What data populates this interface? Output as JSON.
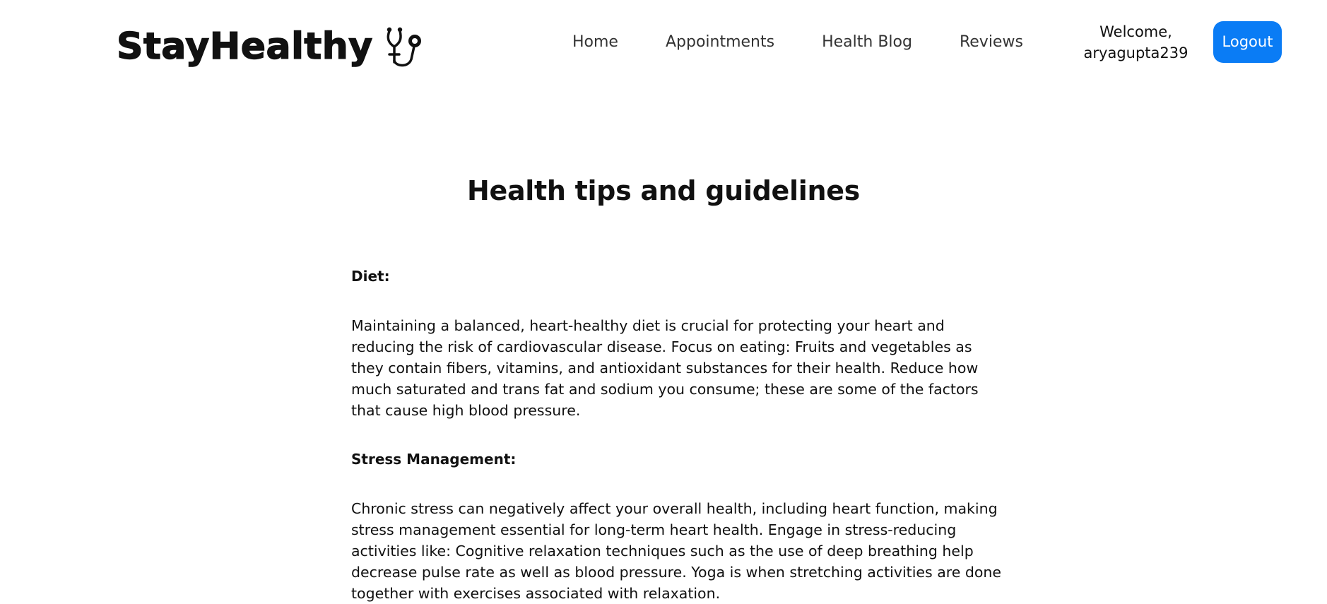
{
  "header": {
    "brand": "StayHealthy",
    "nav": [
      {
        "label": "Home"
      },
      {
        "label": "Appointments"
      },
      {
        "label": "Health Blog"
      },
      {
        "label": "Reviews"
      }
    ],
    "welcome_line1": "Welcome,",
    "welcome_line2": "aryagupta239",
    "logout_label": "Logout"
  },
  "main": {
    "title": "Health tips and guidelines",
    "sections": [
      {
        "heading": "Diet:",
        "body": "Maintaining a balanced, heart-healthy diet is crucial for protecting your heart and reducing the risk of cardiovascular disease. Focus on eating: Fruits and vegetables as they contain fibers, vitamins, and antioxidant substances for their health. Reduce how much saturated and trans fat and sodium you consume; these are some of the factors that cause high blood pressure."
      },
      {
        "heading": "Stress Management:",
        "body": "Chronic stress can negatively affect your overall health, including heart function, making stress management essential for long-term heart health. Engage in stress-reducing activities like: Cognitive relaxation techniques such as the use of deep breathing help decrease pulse rate as well as blood pressure. Yoga is when stretching activities are done together with exercises associated with relaxation."
      }
    ]
  },
  "colors": {
    "accent": "#0a7cf5",
    "text": "#111111",
    "nav_text": "#333333",
    "background": "#ffffff"
  },
  "icons": {
    "brand_icon": "stethoscope-icon"
  }
}
